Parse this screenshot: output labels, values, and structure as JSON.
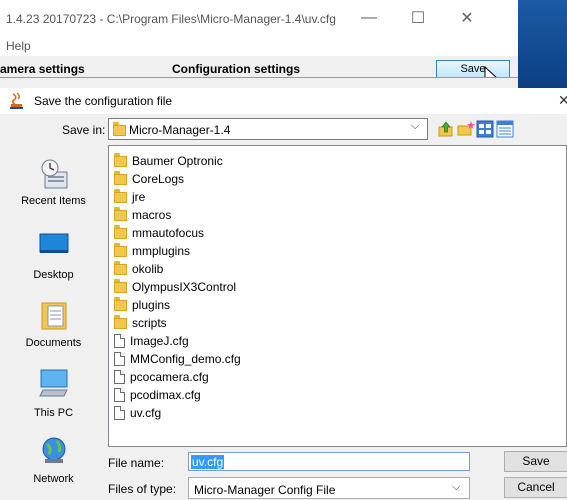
{
  "background_window": {
    "title": "1.4.23 20170723 - C:\\Program Files\\Micro-Manager-1.4\\uv.cfg",
    "menu": [
      "Help"
    ],
    "camera_settings_label": "amera settings",
    "configuration_settings_label": "Configuration settings",
    "save_label": "Save",
    "controls": {
      "minimize": "—",
      "maximize": "☐",
      "close": "✕"
    }
  },
  "dialog": {
    "title": "Save the configuration file",
    "close": "✕",
    "save_in_label": "Save in:",
    "save_in_value": "Micro-Manager-1.4",
    "places": [
      {
        "label": "Recent Items",
        "icon": "recent-items-icon"
      },
      {
        "label": "Desktop",
        "icon": "desktop-icon"
      },
      {
        "label": "Documents",
        "icon": "documents-icon"
      },
      {
        "label": "This PC",
        "icon": "this-pc-icon"
      },
      {
        "label": "Network",
        "icon": "network-icon"
      }
    ],
    "files": [
      {
        "name": "Baumer Optronic",
        "type": "folder"
      },
      {
        "name": "CoreLogs",
        "type": "folder"
      },
      {
        "name": "jre",
        "type": "folder"
      },
      {
        "name": "macros",
        "type": "folder"
      },
      {
        "name": "mmautofocus",
        "type": "folder"
      },
      {
        "name": "mmplugins",
        "type": "folder"
      },
      {
        "name": "okolib",
        "type": "folder"
      },
      {
        "name": "OlympusIX3Control",
        "type": "folder"
      },
      {
        "name": "plugins",
        "type": "folder"
      },
      {
        "name": "scripts",
        "type": "folder"
      },
      {
        "name": "ImageJ.cfg",
        "type": "file"
      },
      {
        "name": "MMConfig_demo.cfg",
        "type": "file"
      },
      {
        "name": "pcocamera.cfg",
        "type": "file"
      },
      {
        "name": "pcodimax.cfg",
        "type": "file"
      },
      {
        "name": "uv.cfg",
        "type": "file"
      }
    ],
    "file_name_label": "File name:",
    "file_name_value": "uv.cfg",
    "files_of_type_label": "Files of type:",
    "files_of_type_value": "Micro-Manager Config File",
    "save_button": "Save",
    "cancel_button": "Cancel"
  }
}
